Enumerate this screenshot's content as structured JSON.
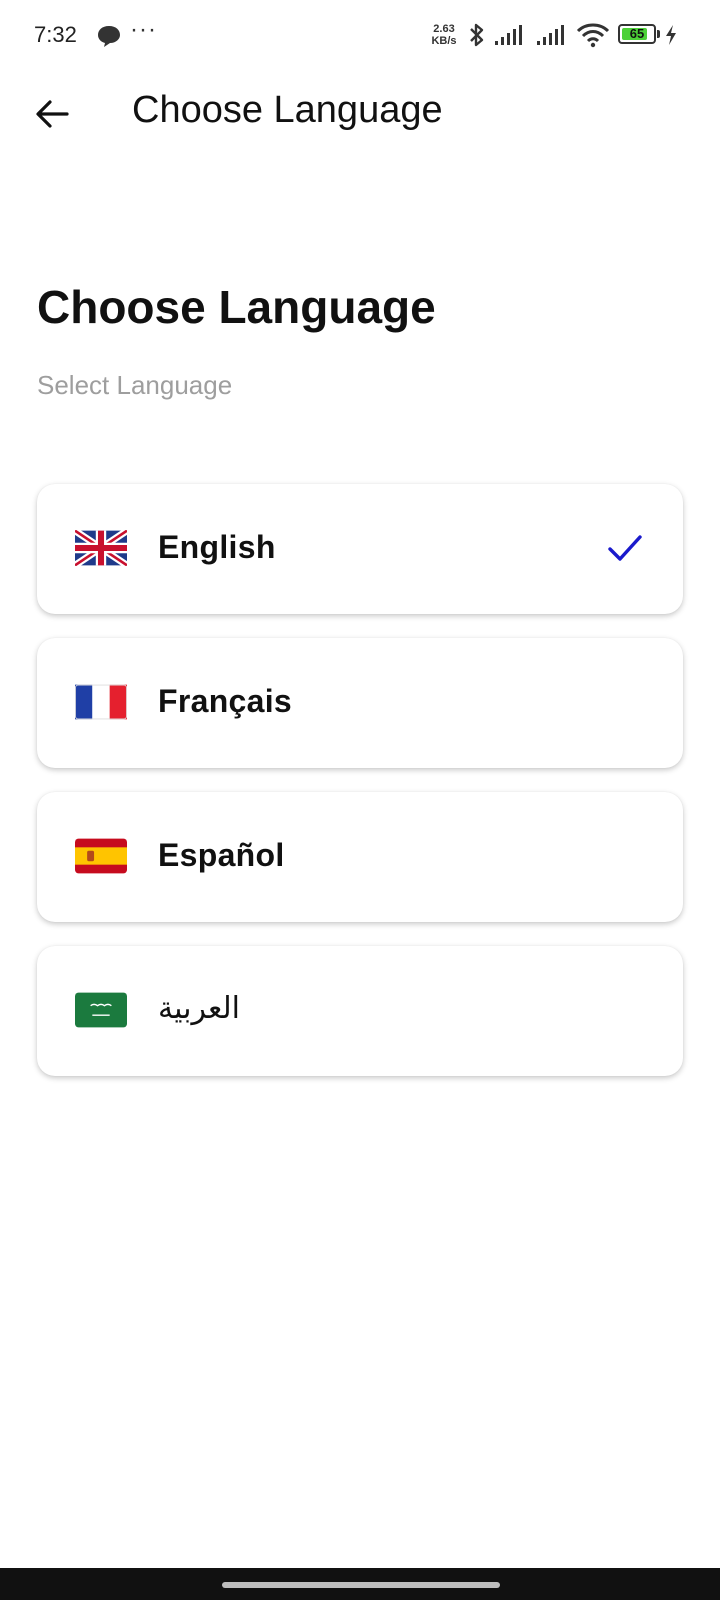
{
  "status_bar": {
    "time": "7:32",
    "more": "···",
    "speed_value": "2.63",
    "speed_unit": "KB/s",
    "battery": "65",
    "icons": [
      "message-icon",
      "bluetooth-icon",
      "signal-icon",
      "signal-icon",
      "wifi-icon",
      "battery-icon",
      "charging-icon"
    ]
  },
  "app_bar": {
    "title": "Choose Language",
    "back_icon": "arrow-left-icon"
  },
  "page": {
    "heading": "Choose Language",
    "subheading": "Select Language"
  },
  "languages": [
    {
      "label": "English",
      "flag": "uk-flag-icon",
      "selected": true
    },
    {
      "label": "Français",
      "flag": "france-flag-icon",
      "selected": false
    },
    {
      "label": "Español",
      "flag": "spain-flag-icon",
      "selected": false
    },
    {
      "label": "العربية",
      "flag": "saudi-flag-icon",
      "selected": false
    }
  ],
  "colors": {
    "accent_check": "#1a1acc",
    "subtitle": "#9e9e9e",
    "battery_fill": "#4cd137"
  }
}
